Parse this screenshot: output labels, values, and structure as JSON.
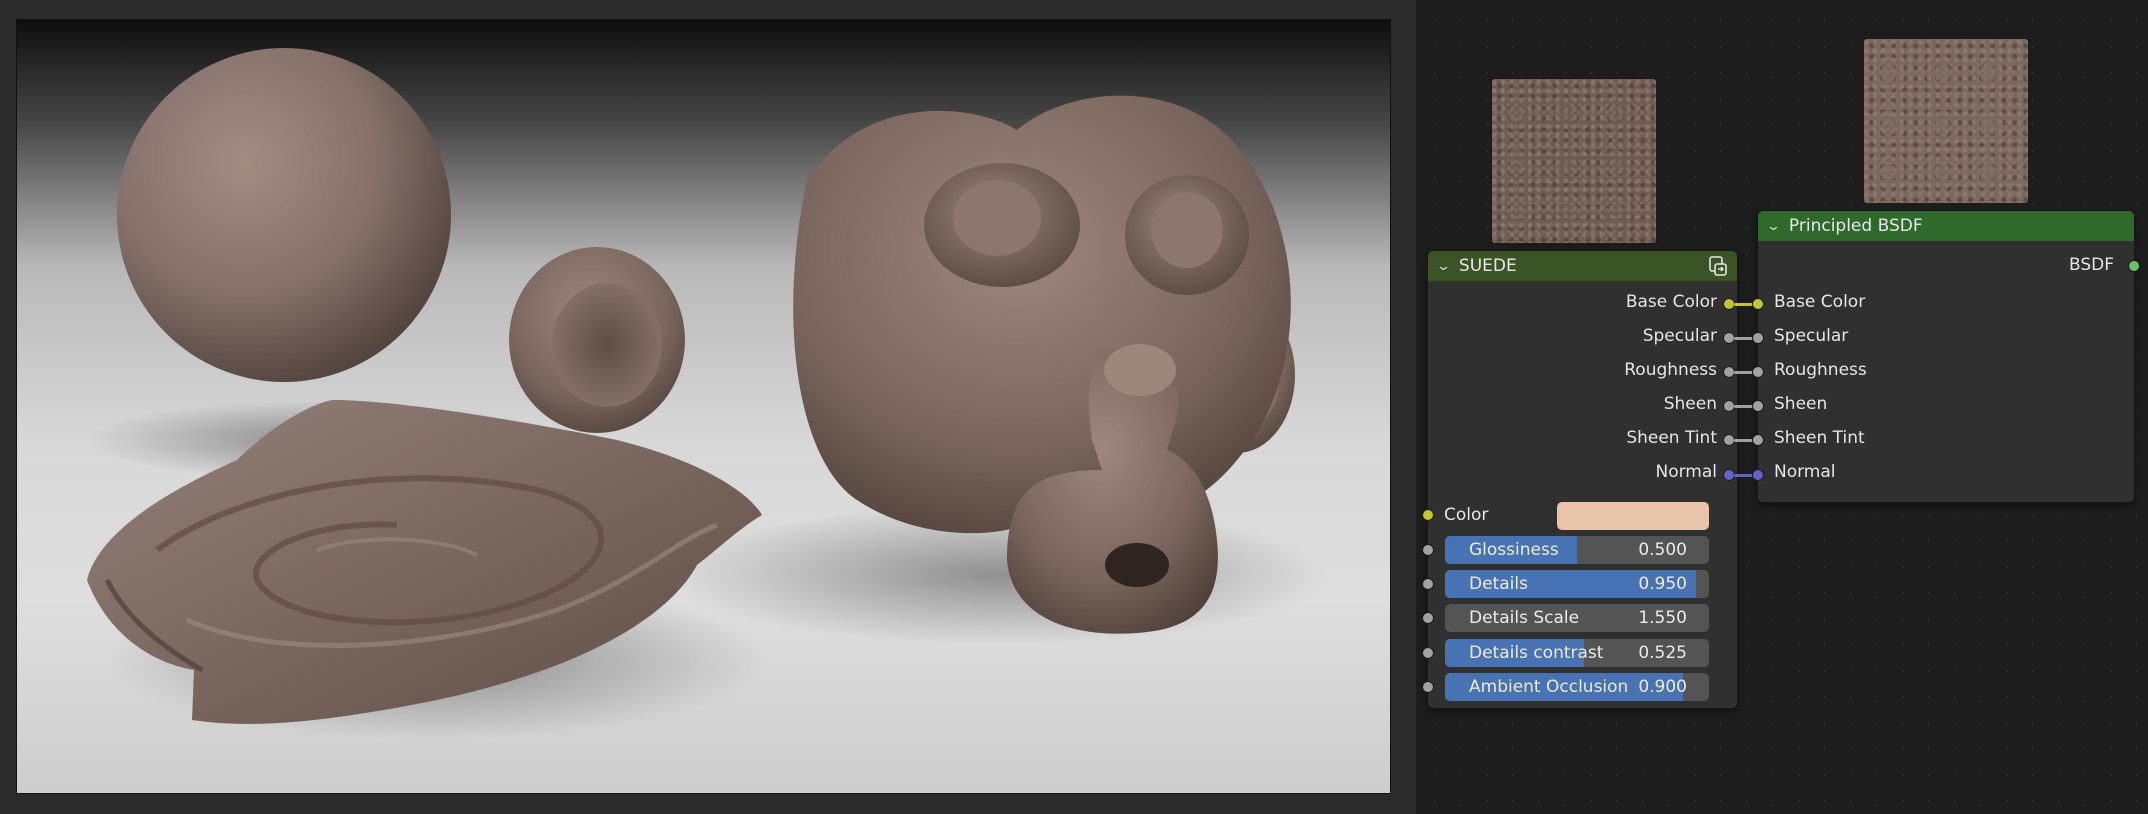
{
  "colors": {
    "suede_header": "#3b5425",
    "bsdf_header": "#2f6a2c",
    "socket_color": "#c7c729",
    "socket_float": "#a1a1a1",
    "socket_vector": "#6363c7",
    "socket_shader": "#63c763",
    "slider_fill": "#4772b3",
    "color_swatch": "#e8c4aa"
  },
  "suede_node": {
    "title": "SUEDE",
    "header_icon": "node-group-icon",
    "outputs": [
      "Base Color",
      "Specular",
      "Roughness",
      "Sheen",
      "Sheen Tint",
      "Normal"
    ],
    "color_input_label": "Color",
    "fields": [
      {
        "label": "Glossiness",
        "value": "0.500",
        "fraction": 0.5
      },
      {
        "label": "Details",
        "value": "0.950",
        "fraction": 0.95
      },
      {
        "label": "Details Scale",
        "value": "1.550",
        "fraction": 0.0
      },
      {
        "label": "Details contrast",
        "value": "0.525",
        "fraction": 0.525
      },
      {
        "label": "Ambient Occlusion",
        "value": "0.900",
        "fraction": 0.9
      }
    ]
  },
  "bsdf_node": {
    "title": "Principled BSDF",
    "output_label": "BSDF",
    "inputs": [
      "Base Color",
      "Specular",
      "Roughness",
      "Sheen",
      "Sheen Tint",
      "Normal"
    ]
  }
}
